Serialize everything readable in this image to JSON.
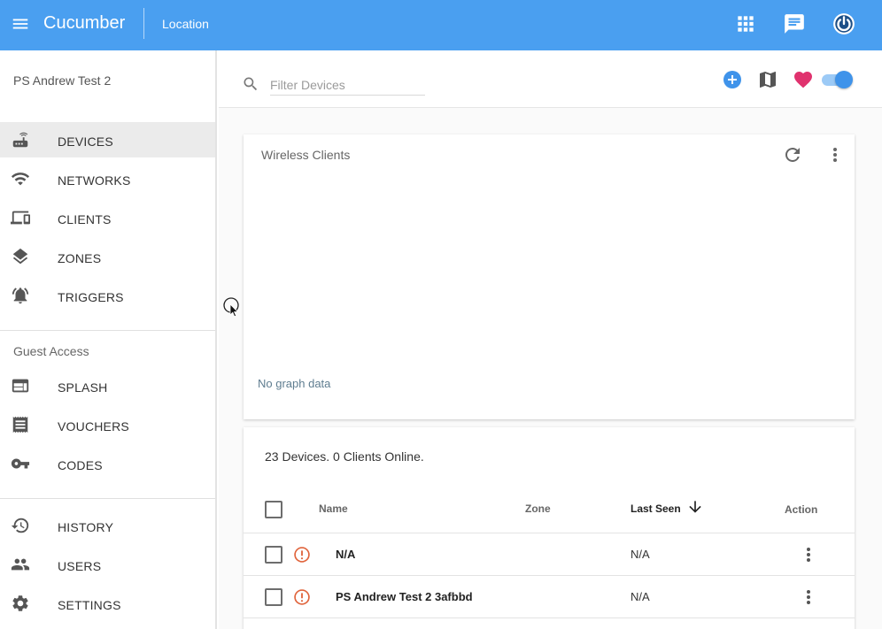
{
  "app": {
    "title": "Cucumber",
    "breadcrumb": "Location",
    "accent_color": "#4a9ff0"
  },
  "header": {
    "icons": [
      "menu-icon",
      "apps-icon",
      "chat-icon",
      "power-icon"
    ]
  },
  "sidebar": {
    "location_name": "PS Andrew Test 2",
    "main_items": [
      {
        "label": "DEVICES",
        "icon": "router-icon",
        "active": true
      },
      {
        "label": "NETWORKS",
        "icon": "wifi-icon",
        "active": false
      },
      {
        "label": "CLIENTS",
        "icon": "devices-icon",
        "active": false
      },
      {
        "label": "ZONES",
        "icon": "layers-icon",
        "active": false
      },
      {
        "label": "TRIGGERS",
        "icon": "alarm-icon",
        "active": false
      }
    ],
    "guest_section_label": "Guest Access",
    "guest_items": [
      {
        "label": "SPLASH",
        "icon": "web-icon"
      },
      {
        "label": "VOUCHERS",
        "icon": "receipt-icon"
      },
      {
        "label": "CODES",
        "icon": "key-icon"
      }
    ],
    "bottom_items": [
      {
        "label": "HISTORY",
        "icon": "history-icon"
      },
      {
        "label": "USERS",
        "icon": "people-icon"
      },
      {
        "label": "SETTINGS",
        "icon": "gear-icon"
      }
    ]
  },
  "filter": {
    "placeholder": "Filter Devices",
    "value": "",
    "toolbar_icons": [
      "add-circle-icon",
      "map-icon",
      "heart-icon"
    ],
    "toggle_on": true
  },
  "graph_card": {
    "title": "Wireless Clients",
    "empty_text": "No graph data"
  },
  "devices_table": {
    "summary": "23 Devices. 0 Clients Online.",
    "columns": [
      "Name",
      "Zone",
      "Last Seen",
      "Action"
    ],
    "sort_column": "Last Seen",
    "sort_direction": "descending",
    "rows": [
      {
        "name": "N/A",
        "zone": "",
        "last_seen": "N/A",
        "status": "alert"
      },
      {
        "name": "PS Andrew Test 2 3afbbd",
        "zone": "",
        "last_seen": "N/A",
        "status": "alert"
      }
    ],
    "alert_color": "#e0643c"
  }
}
